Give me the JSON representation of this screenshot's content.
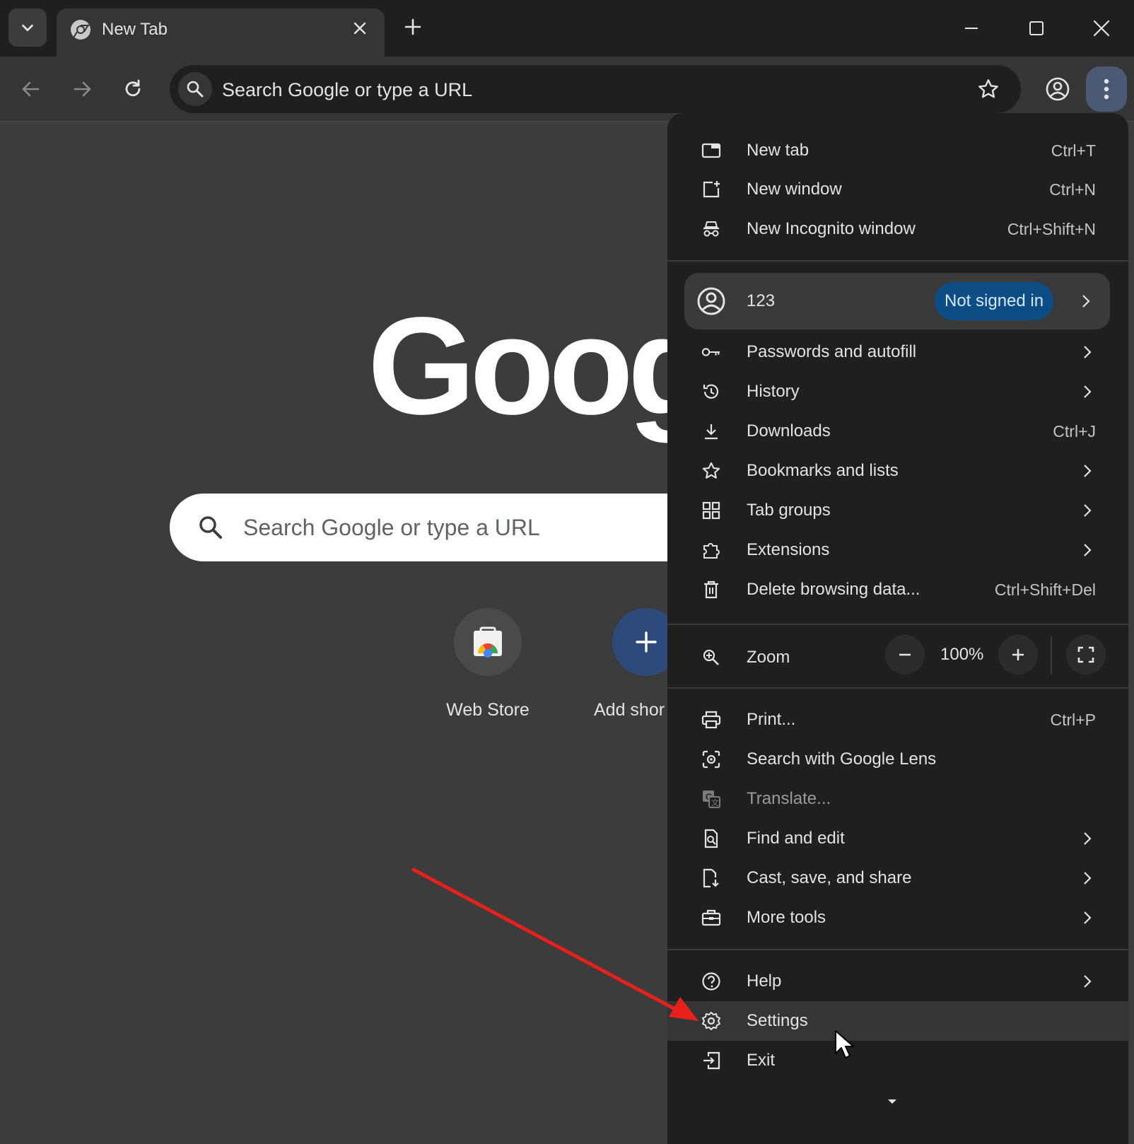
{
  "tabstrip": {
    "tab_title": "New Tab"
  },
  "toolbar": {
    "omnibox_text": "Search Google or type a URL"
  },
  "ntp": {
    "logo_text": "Goog",
    "search_placeholder": "Search Google or type a URL",
    "shortcuts": [
      {
        "label": "Web Store",
        "icon": "web-store-icon"
      },
      {
        "label": "Add shor",
        "icon": "plus-icon"
      }
    ]
  },
  "menu": {
    "group1": [
      {
        "label": "New tab",
        "shortcut": "Ctrl+T",
        "icon": "new-tab-icon"
      },
      {
        "label": "New window",
        "shortcut": "Ctrl+N",
        "icon": "new-window-icon"
      },
      {
        "label": "New Incognito window",
        "shortcut": "Ctrl+Shift+N",
        "icon": "incognito-icon"
      }
    ],
    "profile": {
      "name": "123",
      "badge": "Not signed in"
    },
    "group2": [
      {
        "label": "Passwords and autofill",
        "icon": "key-icon"
      },
      {
        "label": "History",
        "icon": "history-icon"
      },
      {
        "label": "Downloads",
        "shortcut": "Ctrl+J",
        "icon": "download-icon"
      },
      {
        "label": "Bookmarks and lists",
        "icon": "star-icon"
      },
      {
        "label": "Tab groups",
        "icon": "tab-groups-icon"
      },
      {
        "label": "Extensions",
        "icon": "puzzle-icon"
      },
      {
        "label": "Delete browsing data...",
        "shortcut": "Ctrl+Shift+Del",
        "icon": "trash-icon"
      }
    ],
    "zoom": {
      "label": "Zoom",
      "value": "100%"
    },
    "group3": [
      {
        "label": "Print...",
        "shortcut": "Ctrl+P",
        "icon": "print-icon"
      },
      {
        "label": "Search with Google Lens",
        "icon": "lens-icon"
      },
      {
        "label": "Translate...",
        "icon": "translate-icon"
      },
      {
        "label": "Find and edit",
        "icon": "find-icon"
      },
      {
        "label": "Cast, save, and share",
        "icon": "cast-save-icon"
      },
      {
        "label": "More tools",
        "icon": "toolbox-icon"
      }
    ],
    "group4": [
      {
        "label": "Help",
        "icon": "help-icon"
      },
      {
        "label": "Settings",
        "icon": "gear-icon"
      },
      {
        "label": "Exit",
        "icon": "exit-icon"
      }
    ]
  },
  "colors": {
    "accent_menu_button": "#4a5a75",
    "badge_bg": "#0b4d84",
    "annotation_arrow": "#e8201c"
  }
}
